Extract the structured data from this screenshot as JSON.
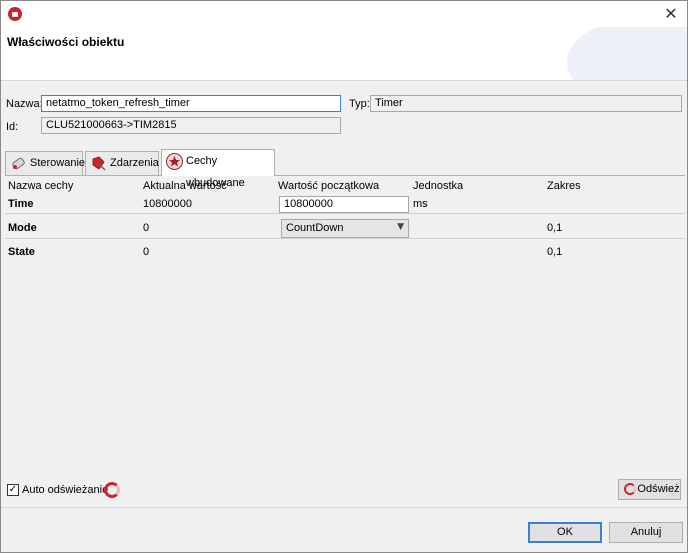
{
  "window": {
    "header_title": "Właściwości obiektu"
  },
  "form": {
    "name_label": "Nazwa:",
    "name_value": "netatmo_token_refresh_timer",
    "type_label": "Typ:",
    "type_value": "Timer",
    "id_label": "Id:",
    "id_value": "CLU521000663->TIM2815"
  },
  "tabs": [
    {
      "label": "Sterowanie",
      "icon": "remote-control-icon"
    },
    {
      "label": "Zdarzenia",
      "icon": "events-icon"
    },
    {
      "label": "Cechy wbudowane",
      "icon": "star-badge-icon"
    }
  ],
  "grid": {
    "headers": [
      "Nazwa cechy",
      "Aktualna wartość",
      "Wartość początkowa",
      "Jednostka",
      "Zakres"
    ],
    "rows": [
      {
        "name": "Time",
        "current": "10800000",
        "initial": "10800000",
        "unit": "ms",
        "range": ""
      },
      {
        "name": "Mode",
        "current": "0",
        "initial": "CountDown",
        "unit": "",
        "range": "0,1"
      },
      {
        "name": "State",
        "current": "0",
        "initial": "",
        "unit": "",
        "range": "0,1"
      }
    ]
  },
  "bottom": {
    "auto_refresh_label": "Auto odświeżanie",
    "auto_refresh_checked": "✓",
    "refresh_button": "Odśwież"
  },
  "footer": {
    "ok": "OK",
    "cancel": "Anuluj"
  },
  "colors": {
    "accent": "#c8262b",
    "focus": "#3c7fd1"
  }
}
